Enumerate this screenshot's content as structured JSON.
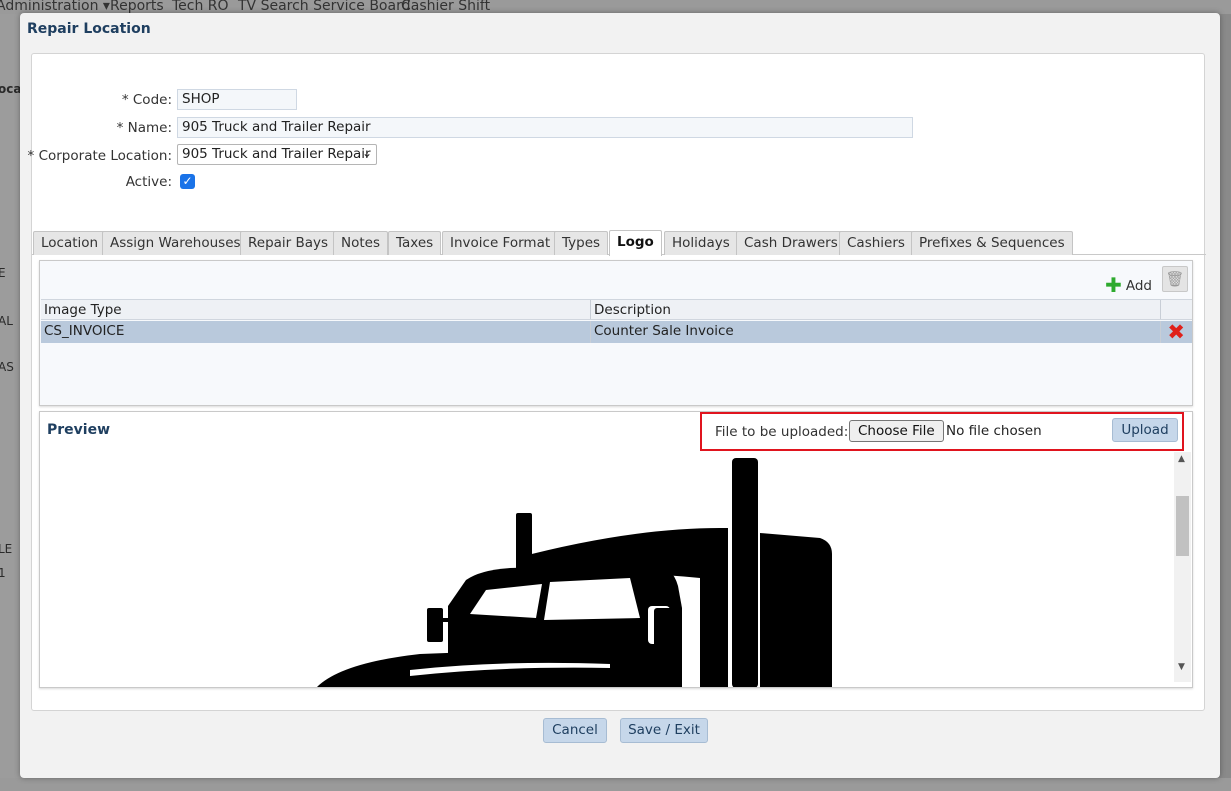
{
  "background": {
    "nav": [
      "Administration ▾",
      "Reports",
      "Tech RO",
      "TV Search Service Board",
      "Cashier Shift"
    ],
    "side_fragments": [
      "ocat",
      "E",
      "AL",
      "AS",
      "LE",
      "1"
    ]
  },
  "dialog": {
    "title": "Repair Location",
    "form": {
      "code_label": "* Code:",
      "code_value": "SHOP",
      "name_label": "* Name:",
      "name_value": "905 Truck and Trailer Repair",
      "corp_label": "* Corporate Location:",
      "corp_value": "905 Truck and Trailer Repair",
      "active_label": "Active:",
      "active_checked": true
    },
    "tabs": [
      "Location",
      "Assign Warehouses",
      "Repair Bays",
      "Notes",
      "Taxes",
      "Invoice Format",
      "Types",
      "Logo",
      "Holidays",
      "Cash Drawers",
      "Cashiers",
      "Prefixes & Sequences"
    ],
    "active_tab": "Logo",
    "grid": {
      "add_label": "Add",
      "columns": [
        "Image Type",
        "Description"
      ],
      "rows": [
        {
          "image_type": "CS_INVOICE",
          "description": "Counter Sale Invoice"
        }
      ]
    },
    "preview": {
      "title": "Preview",
      "upload_label": "File to be uploaded:",
      "choose_label": "Choose File",
      "no_file_text": "No file chosen",
      "upload_button": "Upload"
    },
    "footer": {
      "cancel": "Cancel",
      "save_exit": "Save / Exit"
    }
  },
  "colors": {
    "title_blue": "#1f3f60",
    "button_bg": "#c6d7ea",
    "selected_row": "#b9c9dc",
    "highlight_red": "#e0141e",
    "delete_red": "#e0201a",
    "add_green": "#2eaa2e"
  },
  "icons": [
    "caret-down-icon",
    "checkmark-icon",
    "plus-icon",
    "trash-icon",
    "delete-x-icon",
    "scroll-up-icon",
    "scroll-down-icon",
    "truck-logo-image"
  ]
}
